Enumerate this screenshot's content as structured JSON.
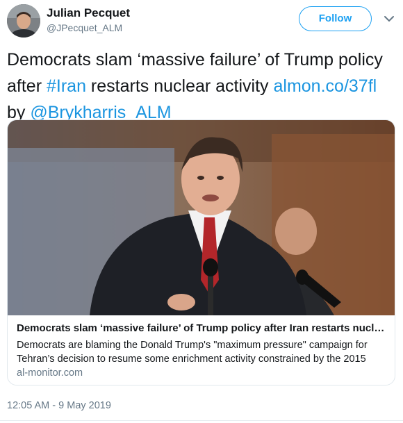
{
  "author": {
    "name": "Julian Pecquet",
    "handle": "@JPecquet_ALM"
  },
  "follow_button": {
    "label": "Follow"
  },
  "tweet": {
    "text_part1": "Democrats slam ‘massive failure’ of Trump policy after ",
    "hashtag": "#Iran",
    "text_part2": " restarts nuclear activity ",
    "link": "almon.co/37fl",
    "text_by": " by ",
    "mention": "@Brykharris_ALM"
  },
  "card": {
    "title": "Democrats slam ‘massive failure’ of Trump policy after Iran restarts nuclear a...",
    "description": "Democrats are blaming the Donald Trump's \"maximum pressure\" campaign for Tehran’s decision to resume some enrichment activity constrained by the 2015",
    "domain": "al-monitor.com"
  },
  "timestamp": "12:05 AM - 9 May 2019",
  "colors": {
    "accent": "#1da1f2",
    "link": "#1b95e0",
    "secondary_text": "#657786",
    "border": "#e1e8ed"
  }
}
